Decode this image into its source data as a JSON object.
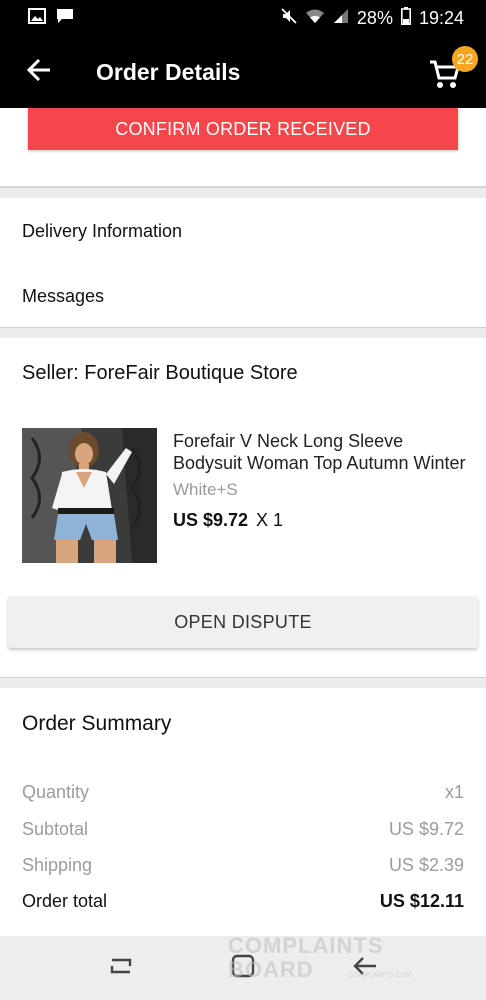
{
  "status_bar": {
    "battery": "28%",
    "time": "19:24",
    "icons": [
      "gallery-icon",
      "message-icon",
      "mute-icon",
      "wifi-icon",
      "signal-icon",
      "battery-icon"
    ]
  },
  "app_bar": {
    "title": "Order Details",
    "cart_count": "22"
  },
  "actions": {
    "confirm_label": "CONFIRM ORDER RECEIVED",
    "dispute_label": "OPEN DISPUTE"
  },
  "info_links": [
    {
      "label": "Delivery Information"
    },
    {
      "label": "Messages"
    }
  ],
  "seller": {
    "label": "Seller: ForeFair Boutique Store"
  },
  "product": {
    "title_line1": "Forefair V Neck Long Sleeve",
    "title_line2": "Bodysuit Woman Top Autumn Winter",
    "variant": "White+S",
    "price": "US $9.72",
    "quantity": "X 1"
  },
  "summary": {
    "title": "Order Summary",
    "rows": [
      {
        "label": "Quantity",
        "value": "x1"
      },
      {
        "label": "Subtotal",
        "value": "US $9.72"
      },
      {
        "label": "Shipping",
        "value": "US $2.39"
      },
      {
        "label": "Order total",
        "value": "US $12.11"
      }
    ]
  },
  "watermark": {
    "line1": "COMPLAINTS",
    "line2": "BOARD",
    "sub": "COMPLAINTS.COM"
  },
  "colors": {
    "accent_red": "#f5474b",
    "badge_orange": "#f5a623",
    "app_bar_black": "#000000"
  }
}
